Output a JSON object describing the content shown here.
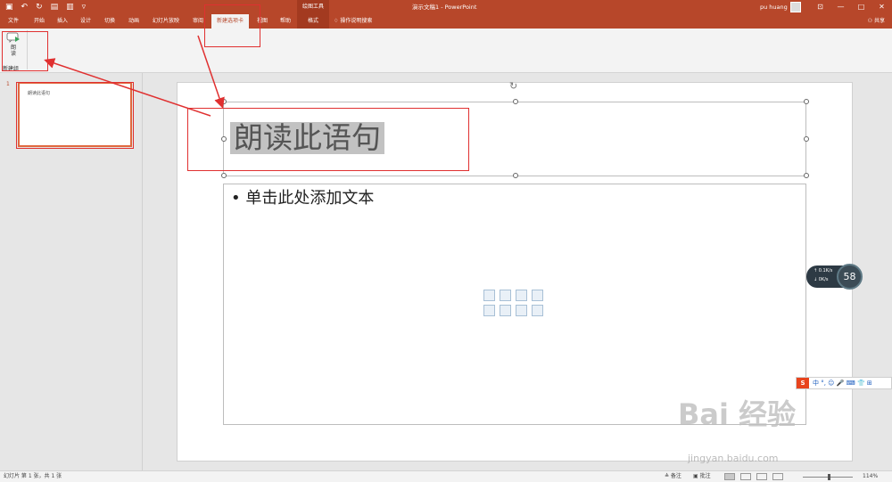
{
  "titlebar": {
    "context_group": "绘图工具",
    "document_title": "演示文稿1  -  PowerPoint",
    "user_name": "pu huang",
    "window_buttons": [
      "—",
      "□",
      "✕"
    ]
  },
  "tabs": [
    {
      "label": "文件",
      "active": false
    },
    {
      "label": "开始",
      "active": false
    },
    {
      "label": "插入",
      "active": false
    },
    {
      "label": "设计",
      "active": false
    },
    {
      "label": "切换",
      "active": false
    },
    {
      "label": "动画",
      "active": false
    },
    {
      "label": "幻灯片放映",
      "active": false
    },
    {
      "label": "审阅",
      "active": false
    },
    {
      "label": "新建选项卡",
      "active": true
    },
    {
      "label": "视图",
      "active": false
    },
    {
      "label": "帮助",
      "active": false
    },
    {
      "label": "格式",
      "active": false
    }
  ],
  "search_label": "操作说明搜索",
  "share_label": "共享",
  "ribbon": {
    "read_button_label": "朗读",
    "group_name": "新建组"
  },
  "slide_panel": {
    "slide_number": "1",
    "thumbnail_title": "朗读此语句"
  },
  "slide": {
    "title_text": "朗读此语句",
    "body_text": "• 单击此处添加文本"
  },
  "net_widget": {
    "upload": "↑ 0.1K/s",
    "download": "↓ 0K/s",
    "percent": "58"
  },
  "ime_bar": {
    "logo": "S",
    "text": "中 °, ☺ 🎤 ⌨ 👕 ⊞"
  },
  "watermark": {
    "main": "Bai 经验",
    "sub": "jingyan.baidu.com"
  },
  "statusbar": {
    "slide_info": "幻灯片 第 1 张，共 1 张",
    "notes": "≜ 备注",
    "comments": "▣ 批注",
    "zoom": "114%"
  },
  "colors": {
    "ribbon_brand": "#b7472a",
    "annotation": "#e03030"
  }
}
